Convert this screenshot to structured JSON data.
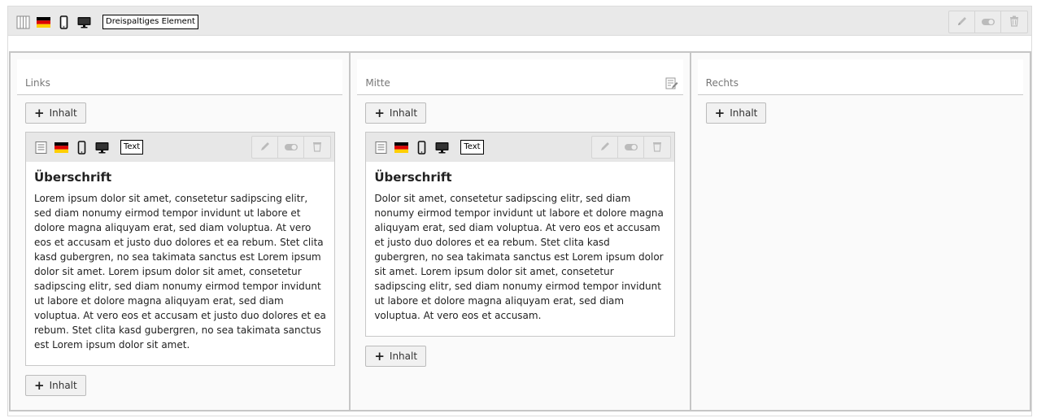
{
  "container": {
    "label": "Dreispaltiges Element",
    "icons": [
      "grid-columns-icon",
      "german-flag-icon",
      "mobile-icon",
      "desktop-icon"
    ],
    "actions": [
      "pencil-icon",
      "toggle-icon",
      "trash-icon"
    ]
  },
  "columns": [
    {
      "title": "Links",
      "add_top": "Inhalt",
      "element": {
        "label": "Text",
        "heading": "Überschrift",
        "body": "Lorem ipsum dolor sit amet, consetetur sadipscing elitr, sed diam nonumy eirmod tempor invidunt ut labore et dolore magna aliquyam erat, sed diam voluptua. At vero eos et accusam et justo duo dolores et ea rebum. Stet clita kasd gubergren, no sea takimata sanctus est Lorem ipsum dolor sit amet. Lorem ipsum dolor sit amet, consetetur sadipscing elitr, sed diam nonumy eirmod tempor invidunt ut labore et dolore magna aliquyam erat, sed diam voluptua. At vero eos et accusam et justo duo dolores et ea rebum. Stet clita kasd gubergren, no sea takimata sanctus est Lorem ipsum dolor sit amet."
      },
      "add_bottom": "Inhalt"
    },
    {
      "title": "Mitte",
      "add_top": "Inhalt",
      "element": {
        "label": "Text",
        "heading": "Überschrift",
        "body": "Dolor sit amet, consetetur sadipscing elitr, sed diam nonumy eirmod tempor invidunt ut labore et dolore magna aliquyam erat, sed diam voluptua. At vero eos et accusam et justo duo dolores et ea rebum. Stet clita kasd gubergren, no sea takimata sanctus est Lorem ipsum dolor sit amet. Lorem ipsum dolor sit amet, consetetur sadipscing elitr, sed diam nonumy eirmod tempor invidunt ut labore et dolore magna aliquyam erat, sed diam voluptua. At vero eos et accusam."
      },
      "add_bottom": "Inhalt"
    },
    {
      "title": "Rechts",
      "add_top": "Inhalt"
    }
  ],
  "colors": {
    "header_bg": "#e9e9e9",
    "border": "#c6c6c6",
    "button_bg": "#f1f1f1"
  }
}
